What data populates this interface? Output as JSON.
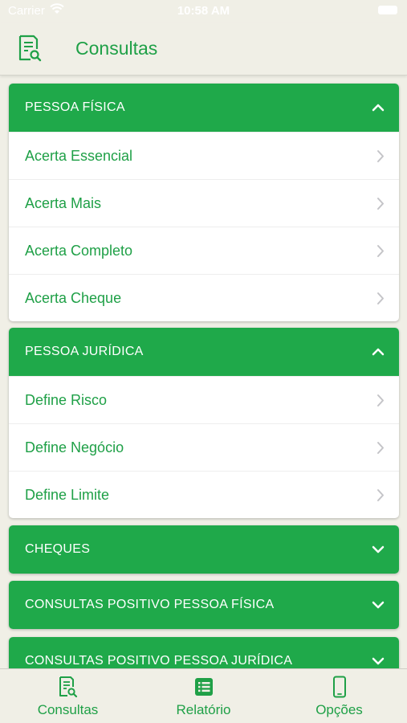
{
  "status_bar": {
    "carrier": "Carrier",
    "time": "10:58 AM"
  },
  "header": {
    "title": "Consultas",
    "icon": "document-search-icon"
  },
  "sections": [
    {
      "title": "PESSOA FÍSICA",
      "expanded": true,
      "items": [
        "Acerta Essencial",
        "Acerta Mais",
        "Acerta Completo",
        "Acerta Cheque"
      ]
    },
    {
      "title": "PESSOA JURÍDICA",
      "expanded": true,
      "items": [
        "Define Risco",
        "Define Negócio",
        "Define Limite"
      ]
    },
    {
      "title": "CHEQUES",
      "expanded": false,
      "items": []
    },
    {
      "title": "CONSULTAS POSITIVO PESSOA FÍSICA",
      "expanded": false,
      "items": []
    },
    {
      "title": "CONSULTAS POSITIVO PESSOA JURÍDICA",
      "expanded": false,
      "items": []
    }
  ],
  "tab_bar": {
    "tabs": [
      {
        "label": "Consultas",
        "icon": "document-search-icon",
        "selected": true
      },
      {
        "label": "Relatório",
        "icon": "list-icon",
        "selected": false
      },
      {
        "label": "Opções",
        "icon": "phone-icon",
        "selected": false
      }
    ]
  },
  "colors": {
    "accent": "#1fa94a",
    "text_green": "#1fa047",
    "background": "#f0efe6"
  }
}
